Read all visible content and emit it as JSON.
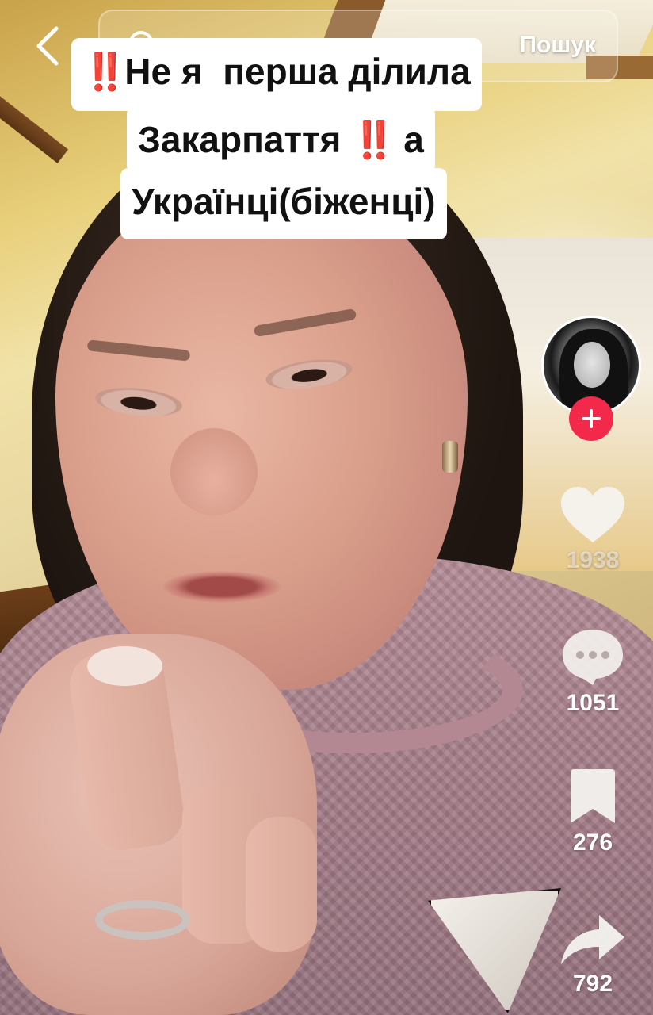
{
  "top_bar": {
    "search_label": "Пошук",
    "back_icon": "chevron-left-icon",
    "search_icon": "search-icon"
  },
  "caption": {
    "line1_mark": "‼️",
    "line1_text": "Не я  перша ділила",
    "line2_text": "Закарпаття",
    "line2_mark": "‼️",
    "line2_tail": "а",
    "line3_text": "Українці(біженці)"
  },
  "right_rail": {
    "follow_icon": "plus-icon",
    "likes": "1938",
    "comments": "1051",
    "favorites": "276",
    "shares": "792"
  },
  "colors": {
    "follow_button": "#f2294b",
    "caption_background": "#ffffff",
    "caption_text": "#111111",
    "caption_mark": "#e0102a"
  }
}
